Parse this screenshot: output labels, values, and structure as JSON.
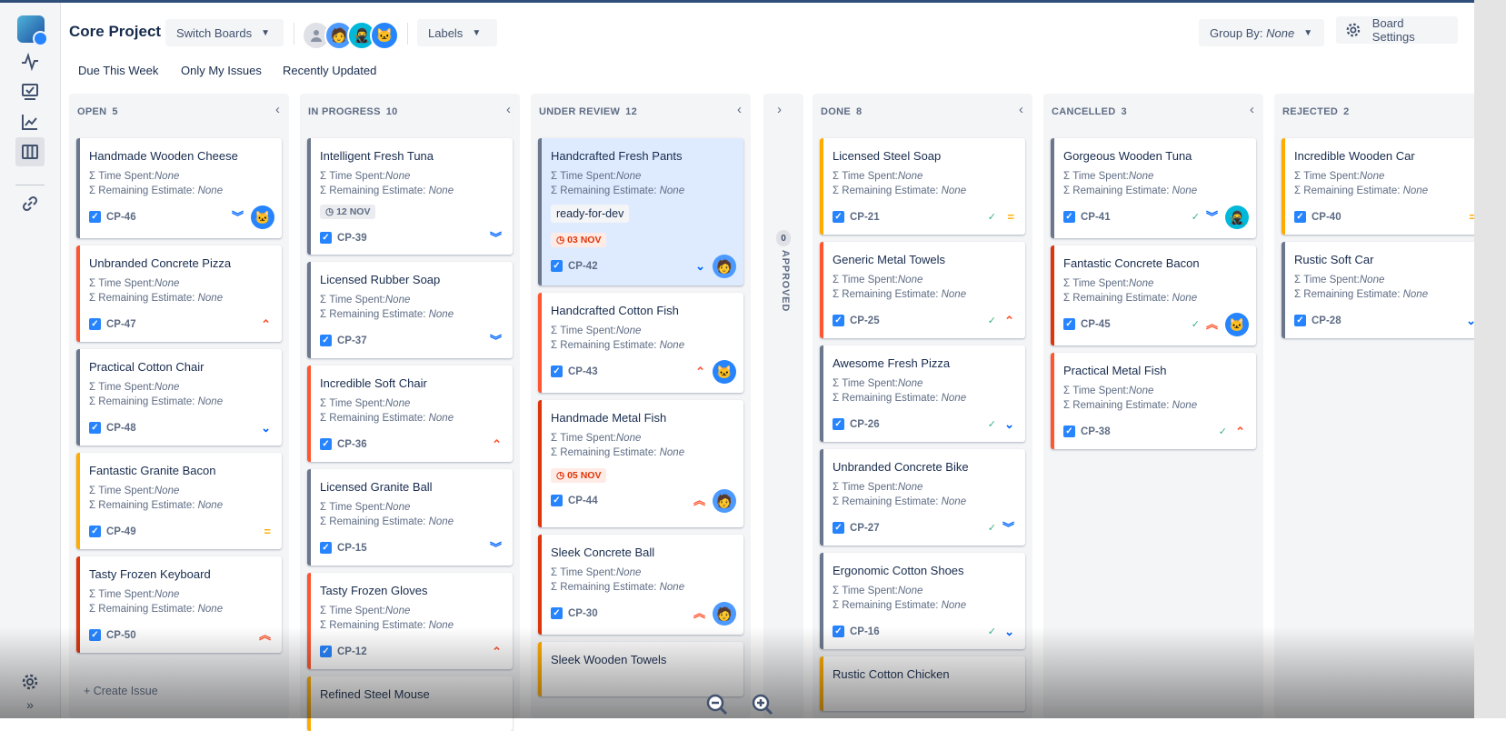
{
  "app": {
    "project_title": "Core Project",
    "switch_boards": "Switch Boards",
    "labels": "Labels",
    "group_by_label": "Group By:",
    "group_by_value": "None",
    "board_settings": "Board Settings"
  },
  "filters": [
    "Due This Week",
    "Only My Issues",
    "Recently Updated"
  ],
  "field_labels": {
    "time_spent": "Σ Time Spent:",
    "remaining": "Σ Remaining Estimate:",
    "none": "None"
  },
  "columns": [
    {
      "title": "OPEN",
      "count": "5",
      "cards": [
        {
          "title": "Handmade Wooden Cheese",
          "key": "CP-46",
          "priority": "lowest",
          "avatar": "cat"
        },
        {
          "title": "Unbranded Concrete Pizza",
          "key": "CP-47",
          "priority": "high"
        },
        {
          "title": "Practical Cotton Chair",
          "key": "CP-48",
          "priority": "low"
        },
        {
          "title": "Fantastic Granite Bacon",
          "key": "CP-49",
          "priority": "medium"
        },
        {
          "title": "Tasty Frozen Keyboard",
          "key": "CP-50",
          "priority": "highest"
        }
      ],
      "create": "+ Create Issue"
    },
    {
      "title": "IN PROGRESS",
      "count": "10",
      "cards": [
        {
          "title": "Intelligent Fresh Tuna",
          "key": "CP-39",
          "priority": "lowest",
          "date": "12 NOV"
        },
        {
          "title": "Licensed Rubber Soap",
          "key": "CP-37",
          "priority": "lowest"
        },
        {
          "title": "Incredible Soft Chair",
          "key": "CP-36",
          "priority": "high"
        },
        {
          "title": "Licensed Granite Ball",
          "key": "CP-15",
          "priority": "lowest"
        },
        {
          "title": "Tasty Frozen Gloves",
          "key": "CP-12",
          "priority": "high"
        },
        {
          "title": "Refined Steel Mouse"
        }
      ]
    },
    {
      "title": "UNDER REVIEW",
      "count": "12",
      "cards": [
        {
          "title": "Handcrafted Fresh Pants",
          "key": "CP-42",
          "priority": "low",
          "label": "ready-for-dev",
          "due": "03 NOV",
          "avatar": "man"
        },
        {
          "title": "Handcrafted Cotton Fish",
          "key": "CP-43",
          "priority": "high",
          "avatar": "cat"
        },
        {
          "title": "Handmade Metal Fish",
          "key": "CP-44",
          "priority": "highest",
          "due": "05 NOV",
          "avatar": "man"
        },
        {
          "title": "Sleek Concrete Ball",
          "key": "CP-30",
          "priority": "highest",
          "avatar": "man"
        },
        {
          "title": "Sleek Wooden Towels"
        }
      ]
    },
    {
      "title": "APPROVED",
      "count": "0",
      "collapsed": true
    },
    {
      "title": "DONE",
      "count": "8",
      "cards": [
        {
          "title": "Licensed Steel Soap",
          "key": "CP-21",
          "priority": "medium",
          "done": true
        },
        {
          "title": "Generic Metal Towels",
          "key": "CP-25",
          "priority": "high",
          "done": true
        },
        {
          "title": "Awesome Fresh Pizza",
          "key": "CP-26",
          "priority": "low",
          "done": true
        },
        {
          "title": "Unbranded Concrete Bike",
          "key": "CP-27",
          "priority": "lowest",
          "done": true
        },
        {
          "title": "Ergonomic Cotton Shoes",
          "key": "CP-16",
          "priority": "low",
          "done": true
        },
        {
          "title": "Rustic Cotton Chicken"
        }
      ]
    },
    {
      "title": "CANCELLED",
      "count": "3",
      "cards": [
        {
          "title": "Gorgeous Wooden Tuna",
          "key": "CP-41",
          "priority": "lowest",
          "done": true,
          "avatar": "ninja"
        },
        {
          "title": "Fantastic Concrete Bacon",
          "key": "CP-45",
          "priority": "highest",
          "done": true,
          "avatar": "cat"
        },
        {
          "title": "Practical Metal Fish",
          "key": "CP-38",
          "priority": "high",
          "done": true
        }
      ]
    },
    {
      "title": "REJECTED",
      "count": "2",
      "cards": [
        {
          "title": "Incredible Wooden Car",
          "key": "CP-40",
          "priority": "medium"
        },
        {
          "title": "Rustic Soft Car",
          "key": "CP-28",
          "priority": "low"
        }
      ]
    }
  ],
  "colors": {
    "accent": "#2684ff",
    "high": "#ff5630",
    "medium": "#ffab00",
    "low": "#0065ff",
    "done": "#36b37e"
  },
  "icons": [
    "activity-icon",
    "board-icon",
    "reports-icon",
    "columns-icon",
    "link-icon",
    "settings-icon",
    "expand-icon",
    "zoom-out-icon",
    "zoom-in-icon",
    "gear-icon"
  ]
}
